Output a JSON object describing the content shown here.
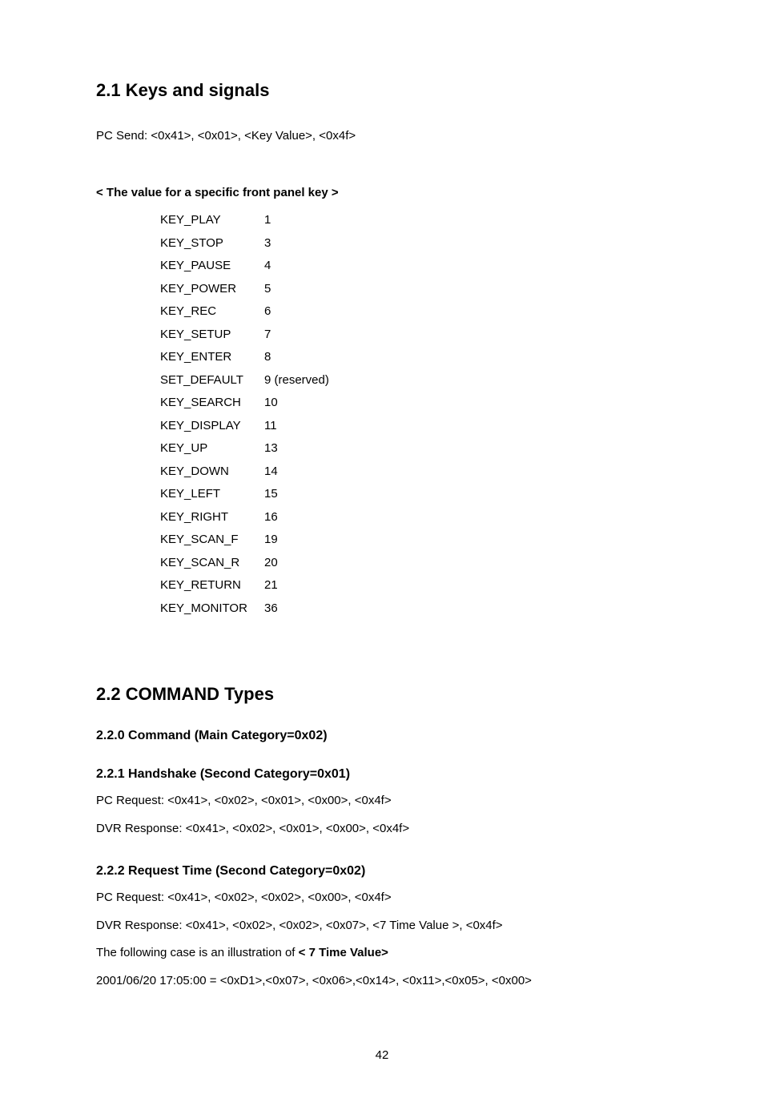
{
  "section21": {
    "title": "2.1 Keys and signals",
    "pc_send": "PC Send: <0x41>, <0x01>, <Key Value>, <0x4f>",
    "table_header": "< The value for a specific front panel key >",
    "keys": [
      {
        "name": "KEY_PLAY",
        "val": "1"
      },
      {
        "name": "KEY_STOP",
        "val": "3"
      },
      {
        "name": "KEY_PAUSE",
        "val": "4"
      },
      {
        "name": "KEY_POWER",
        "val": "5"
      },
      {
        "name": "KEY_REC",
        "val": "6"
      },
      {
        "name": "KEY_SETUP",
        "val": "7"
      },
      {
        "name": "KEY_ENTER",
        "val": "8"
      },
      {
        "name": "SET_DEFAULT",
        "val": "9 (reserved)"
      },
      {
        "name": "KEY_SEARCH",
        "val": "10"
      },
      {
        "name": "KEY_DISPLAY",
        "val": "11"
      },
      {
        "name": "KEY_UP",
        "val": "13"
      },
      {
        "name": "KEY_DOWN",
        "val": "14"
      },
      {
        "name": "KEY_LEFT",
        "val": "15"
      },
      {
        "name": "KEY_RIGHT",
        "val": "16"
      },
      {
        "name": "KEY_SCAN_F",
        "val": "19"
      },
      {
        "name": "KEY_SCAN_R",
        "val": "20"
      },
      {
        "name": "KEY_RETURN",
        "val": "21"
      },
      {
        "name": "KEY_MONITOR",
        "val": "36"
      }
    ]
  },
  "section22": {
    "title": "2.2 COMMAND Types",
    "s220": {
      "title": "2.2.0 Command (Main Category=0x02)"
    },
    "s221": {
      "title": "2.2.1 Handshake (Second Category=0x01)",
      "line1": "PC Request: <0x41>, <0x02>, <0x01>, <0x00>, <0x4f>",
      "line2": "DVR Response: <0x41>, <0x02>, <0x01>, <0x00>, <0x4f>"
    },
    "s222": {
      "title": "2.2.2 Request Time (Second Category=0x02)",
      "line1": "PC Request: <0x41>, <0x02>, <0x02>, <0x00>, <0x4f>",
      "line2": "DVR Response: <0x41>, <0x02>, <0x02>, <0x07>, <7 Time Value >, <0x4f>",
      "line3_pre": "The following case is an illustration of ",
      "line3_bold": "< 7 Time Value>",
      "line4": "2001/06/20 17:05:00 = <0xD1>,<0x07>, <0x06>,<0x14>, <0x11>,<0x05>, <0x00>"
    }
  },
  "page_number": "42"
}
